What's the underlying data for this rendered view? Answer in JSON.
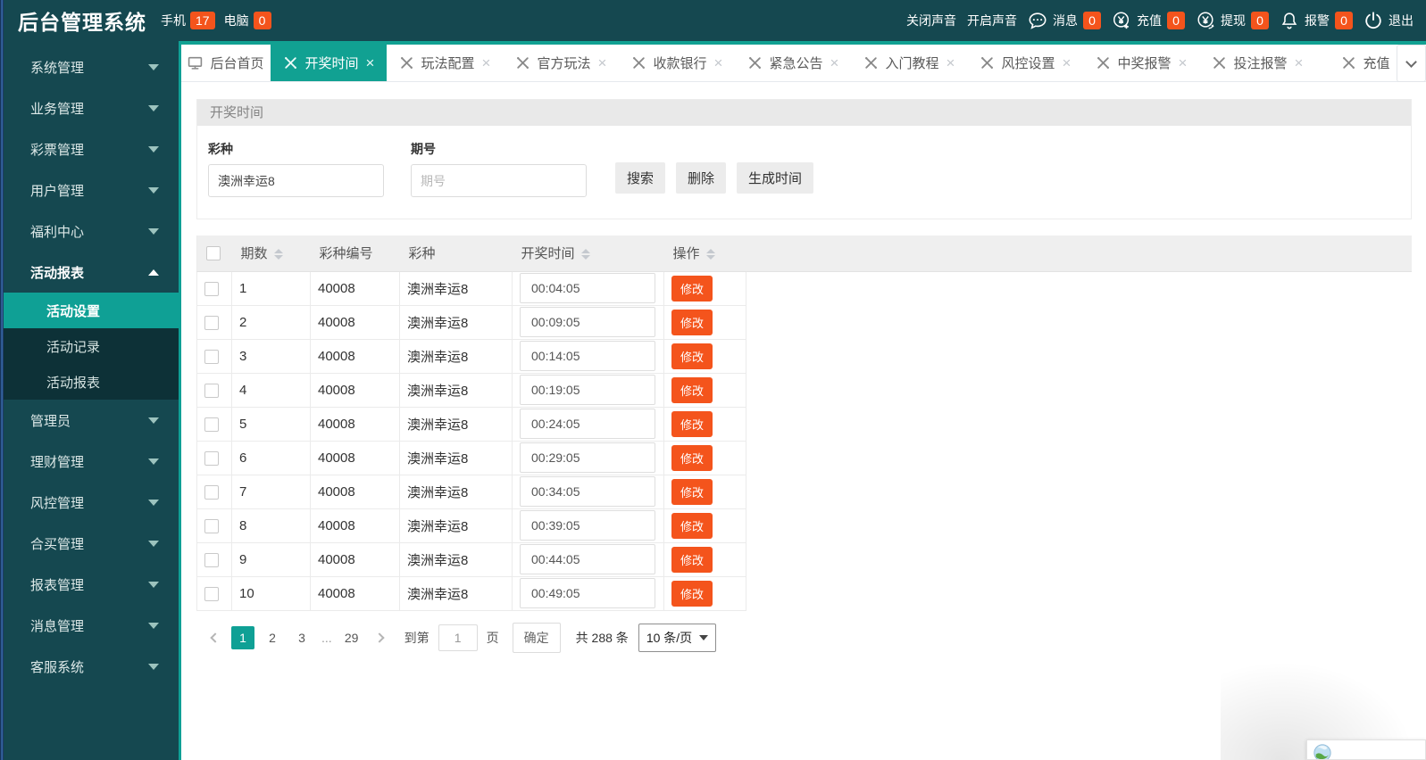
{
  "colors": {
    "accent": "#11a192",
    "dark_teal": "#154850",
    "submenu_bg": "#0d3137",
    "orange": "#f4541c"
  },
  "header": {
    "title": "后台管理系统",
    "stats": [
      {
        "label": "手机",
        "count": "17"
      },
      {
        "label": "电脑",
        "count": "0"
      }
    ],
    "sound_off": "关闭声音",
    "sound_on": "开启声音",
    "actions": [
      {
        "icon": "message-bubble-icon",
        "label": "消息",
        "count": "0"
      },
      {
        "icon": "recharge-yuan-icon",
        "label": "充值",
        "count": "0"
      },
      {
        "icon": "withdraw-yuan-icon",
        "label": "提现",
        "count": "0"
      },
      {
        "icon": "alarm-bell-icon",
        "label": "报警",
        "count": "0"
      }
    ],
    "logout": "退出"
  },
  "sidebar": {
    "items": [
      {
        "label": "系统管理"
      },
      {
        "label": "业务管理"
      },
      {
        "label": "彩票管理"
      },
      {
        "label": "用户管理"
      },
      {
        "label": "福利中心"
      },
      {
        "label": "活动报表",
        "expanded": true,
        "children": [
          {
            "label": "活动设置",
            "active": true
          },
          {
            "label": "活动记录"
          },
          {
            "label": "活动报表"
          }
        ]
      },
      {
        "label": "管理员"
      },
      {
        "label": "理财管理"
      },
      {
        "label": "风控管理"
      },
      {
        "label": "合买管理"
      },
      {
        "label": "报表管理"
      },
      {
        "label": "消息管理"
      },
      {
        "label": "客服系统"
      }
    ]
  },
  "tabs": [
    {
      "label": "后台首页",
      "icon": "monitor",
      "closable": false,
      "active": false
    },
    {
      "label": "开奖时间",
      "icon": "tools",
      "closable": true,
      "active": true
    },
    {
      "label": "玩法配置",
      "icon": "tools",
      "closable": true,
      "active": false
    },
    {
      "label": "官方玩法",
      "icon": "tools",
      "closable": true,
      "active": false
    },
    {
      "label": "收款银行",
      "icon": "tools",
      "closable": true,
      "active": false
    },
    {
      "label": "紧急公告",
      "icon": "tools",
      "closable": true,
      "active": false
    },
    {
      "label": "入门教程",
      "icon": "tools",
      "closable": true,
      "active": false
    },
    {
      "label": "风控设置",
      "icon": "tools",
      "closable": true,
      "active": false
    },
    {
      "label": "中奖报警",
      "icon": "tools",
      "closable": true,
      "active": false
    },
    {
      "label": "投注报警",
      "icon": "tools",
      "closable": true,
      "active": false
    },
    {
      "label": "充值",
      "icon": "tools",
      "closable": true,
      "active": false
    }
  ],
  "main": {
    "panel_title": "开奖时间",
    "filters": {
      "lottery_label": "彩种",
      "lottery_value": "澳洲幸运8",
      "issue_label": "期号",
      "issue_placeholder": "期号",
      "search_button": "搜索",
      "delete_button": "删除",
      "generate_button": "生成时间"
    },
    "table": {
      "columns": [
        {
          "label": "期数",
          "sortable": true
        },
        {
          "label": "彩种编号",
          "sortable": false
        },
        {
          "label": "彩种",
          "sortable": false
        },
        {
          "label": "开奖时间",
          "sortable": true
        },
        {
          "label": "操作",
          "sortable": true
        }
      ],
      "edit_button": "修改",
      "rows": [
        {
          "issue": "1",
          "code": "40008",
          "lottery": "澳洲幸运8",
          "time": "00:04:05"
        },
        {
          "issue": "2",
          "code": "40008",
          "lottery": "澳洲幸运8",
          "time": "00:09:05"
        },
        {
          "issue": "3",
          "code": "40008",
          "lottery": "澳洲幸运8",
          "time": "00:14:05"
        },
        {
          "issue": "4",
          "code": "40008",
          "lottery": "澳洲幸运8",
          "time": "00:19:05"
        },
        {
          "issue": "5",
          "code": "40008",
          "lottery": "澳洲幸运8",
          "time": "00:24:05"
        },
        {
          "issue": "6",
          "code": "40008",
          "lottery": "澳洲幸运8",
          "time": "00:29:05"
        },
        {
          "issue": "7",
          "code": "40008",
          "lottery": "澳洲幸运8",
          "time": "00:34:05"
        },
        {
          "issue": "8",
          "code": "40008",
          "lottery": "澳洲幸运8",
          "time": "00:39:05"
        },
        {
          "issue": "9",
          "code": "40008",
          "lottery": "澳洲幸运8",
          "time": "00:44:05"
        },
        {
          "issue": "10",
          "code": "40008",
          "lottery": "澳洲幸运8",
          "time": "00:49:05"
        }
      ]
    },
    "pagination": {
      "pages": [
        "1",
        "2",
        "3",
        "...",
        "29"
      ],
      "active": "1",
      "goto_prefix": "到第",
      "goto_value": "1",
      "goto_suffix": "页",
      "confirm_button": "确定",
      "total_text": "共 288 条",
      "page_size": "10 条/页"
    }
  }
}
